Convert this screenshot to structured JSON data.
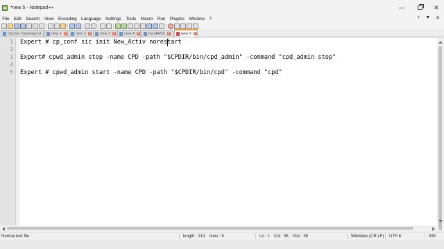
{
  "window": {
    "title": "*new 5 - Notepad++",
    "controls": {
      "minimize": "—",
      "close": "✕"
    }
  },
  "menu": {
    "items": [
      "File",
      "Edit",
      "Search",
      "View",
      "Encoding",
      "Language",
      "Settings",
      "Tools",
      "Macro",
      "Run",
      "Plugins",
      "Window",
      "?"
    ],
    "right": [
      "+",
      "▼",
      "✕"
    ]
  },
  "tabs": [
    {
      "label": "Cluster Topology.txt",
      "close": "x"
    },
    {
      "label": "new 1",
      "close": "x"
    },
    {
      "label": "new 2",
      "close": "x"
    },
    {
      "label": "new 3",
      "close": "x"
    },
    {
      "label": "new 4",
      "close": "x"
    },
    {
      "label": "Fg HA/05",
      "close": "x"
    },
    {
      "label": "new 5",
      "close": "x",
      "active": true
    }
  ],
  "editor": {
    "lines": [
      {
        "number": "1",
        "text": "Expert # cp_conf sic init New_Activ norestart"
      },
      {
        "number": "2",
        "text": ""
      },
      {
        "number": "3",
        "text": "Expert# cpwd_admin stop -name CPD -path \"$CPDIR/bin/cpd_admin\" -command \"cpd_admin stop\""
      },
      {
        "number": "4",
        "text": ""
      },
      {
        "number": "5",
        "text": "Expert # cpwd_admin start -name CPD -path \"$CPDIR/bin/cpd\" -command \"cpd\""
      }
    ]
  },
  "status": {
    "file_type": "Normal text file",
    "length": "length : 213",
    "lines": "lines : 5",
    "ln": "Ln : 1",
    "col": "Col : 35",
    "pos": "Pos : 35",
    "eol": "Windows (CR LF)",
    "encoding": "UTF-8",
    "mode": "INS"
  },
  "colors": {
    "active_tab_accent": "#f2a13a",
    "editor_background": "#ffffff",
    "gutter_background": "#e4e4e4"
  }
}
